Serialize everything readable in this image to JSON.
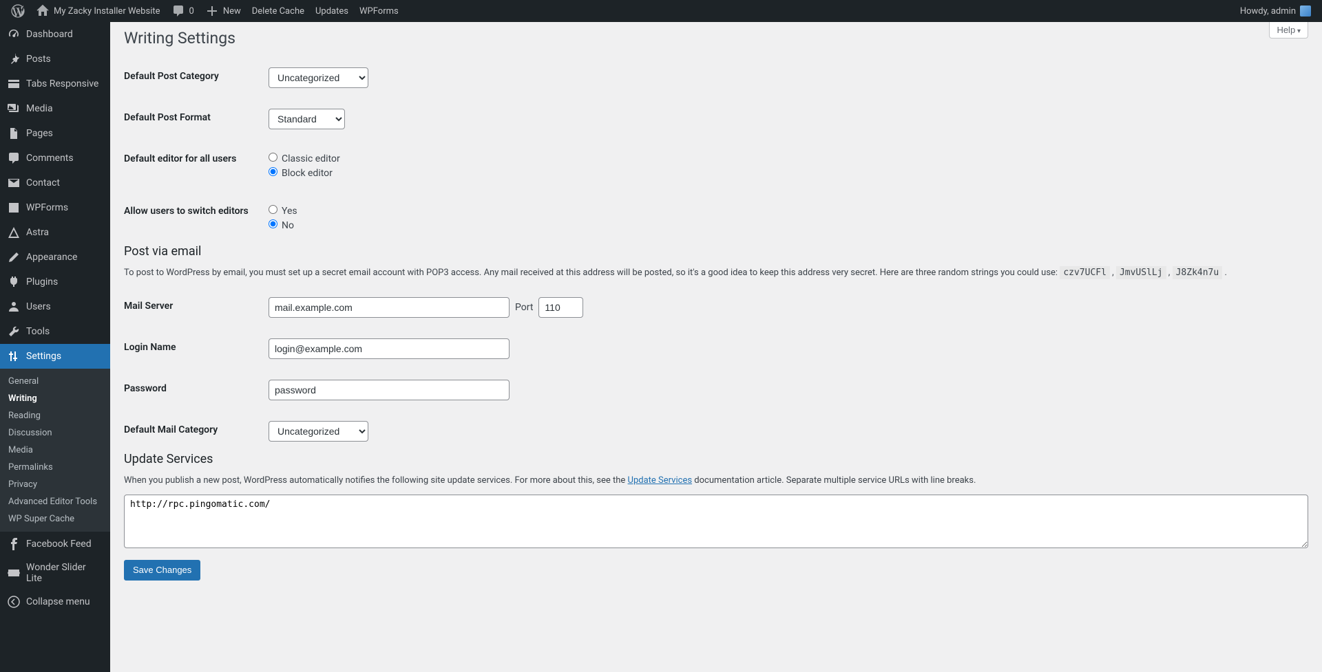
{
  "adminbar": {
    "site_name": "My Zacky Installer Website",
    "comments": "0",
    "new": "New",
    "delete_cache": "Delete Cache",
    "updates": "Updates",
    "wpforms": "WPForms",
    "howdy": "Howdy, admin"
  },
  "sidebar": {
    "items": [
      {
        "label": "Dashboard"
      },
      {
        "label": "Posts"
      },
      {
        "label": "Tabs Responsive"
      },
      {
        "label": "Media"
      },
      {
        "label": "Pages"
      },
      {
        "label": "Comments"
      },
      {
        "label": "Contact"
      },
      {
        "label": "WPForms"
      },
      {
        "label": "Astra"
      },
      {
        "label": "Appearance"
      },
      {
        "label": "Plugins"
      },
      {
        "label": "Users"
      },
      {
        "label": "Tools"
      },
      {
        "label": "Settings"
      },
      {
        "label": "Facebook Feed"
      },
      {
        "label": "Wonder Slider Lite"
      },
      {
        "label": "Collapse menu"
      }
    ],
    "settings_submenu": [
      "General",
      "Writing",
      "Reading",
      "Discussion",
      "Media",
      "Permalinks",
      "Privacy",
      "Advanced Editor Tools",
      "WP Super Cache"
    ]
  },
  "page": {
    "help": "Help",
    "title": "Writing Settings",
    "default_category_label": "Default Post Category",
    "default_category_value": "Uncategorized",
    "default_format_label": "Default Post Format",
    "default_format_value": "Standard",
    "default_editor_label": "Default editor for all users",
    "editor_classic": "Classic editor",
    "editor_block": "Block editor",
    "switch_label": "Allow users to switch editors",
    "switch_yes": "Yes",
    "switch_no": "No",
    "post_email_heading": "Post via email",
    "post_email_desc": "To post to WordPress by email, you must set up a secret email account with POP3 access. Any mail received at this address will be posted, so it's a good idea to keep this address very secret. Here are three random strings you could use: ",
    "random1": "czv7UCFl",
    "random2": "JmvUSlLj",
    "random3": "J8Zk4n7u",
    "mail_server_label": "Mail Server",
    "mail_server_value": "mail.example.com",
    "port_label": "Port",
    "port_value": "110",
    "login_label": "Login Name",
    "login_value": "login@example.com",
    "password_label": "Password",
    "password_value": "password",
    "mail_category_label": "Default Mail Category",
    "mail_category_value": "Uncategorized",
    "update_heading": "Update Services",
    "update_desc_pre": "When you publish a new post, WordPress automatically notifies the following site update services. For more about this, see the ",
    "update_link": "Update Services",
    "update_desc_post": " documentation article. Separate multiple service URLs with line breaks.",
    "ping_sites": "http://rpc.pingomatic.com/",
    "save": "Save Changes"
  }
}
